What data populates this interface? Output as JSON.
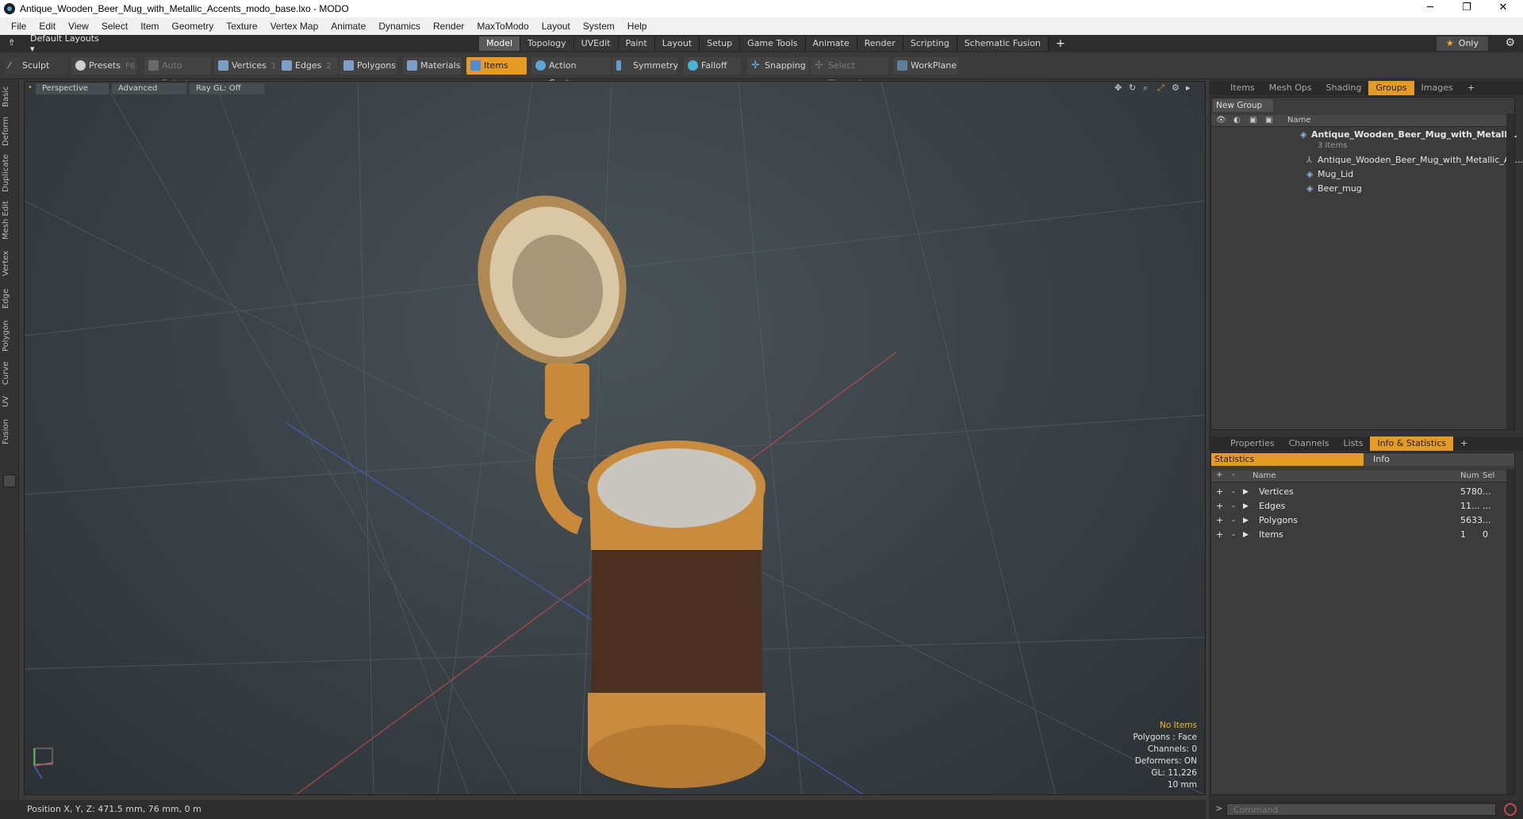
{
  "window": {
    "title": "Antique_Wooden_Beer_Mug_with_Metallic_Accents_modo_base.lxo - MODO",
    "minimize": "─",
    "maximize": "❐",
    "close": "✕"
  },
  "menu": [
    "File",
    "Edit",
    "View",
    "Select",
    "Item",
    "Geometry",
    "Texture",
    "Vertex Map",
    "Animate",
    "Dynamics",
    "Render",
    "MaxToModo",
    "Layout",
    "System",
    "Help"
  ],
  "layoutbar": {
    "layouts_label": "Default Layouts ▾",
    "tabs": [
      "Model",
      "Topology",
      "UVEdit",
      "Paint",
      "Layout",
      "Setup",
      "Game Tools",
      "Animate",
      "Render",
      "Scripting",
      "Schematic Fusion"
    ],
    "active_tab": "Model",
    "add": "+",
    "only_label": "Only"
  },
  "toolbar": {
    "sculpt": "Sculpt",
    "presets": "Presets",
    "presets_hotkey": "F6",
    "auto_select": "Auto Select",
    "vertices": "Vertices",
    "vertices_hotkey": "1",
    "edges": "Edges",
    "edges_hotkey": "2",
    "polygons": "Polygons",
    "materials": "Materials",
    "items": "Items",
    "action_center": "Action Center",
    "symmetry": "Symmetry",
    "falloff": "Falloff",
    "snapping": "Snapping",
    "select_through": "Select Through",
    "workplane": "WorkPlane"
  },
  "left_tabs": [
    "Basic",
    "Deform",
    "Duplicate",
    "Mesh Edit",
    "Vertex",
    "Edge",
    "Polygon",
    "Curve",
    "UV",
    "Fusion"
  ],
  "viewport": {
    "perspective": "Perspective",
    "advanced": "Advanced",
    "raygl": "Ray GL: Off",
    "info": {
      "no_items": "No Items",
      "polygons": "Polygons : Face",
      "channels": "Channels: 0",
      "deformers": "Deformers: ON",
      "gl": "GL: 11,226",
      "scale": "10 mm"
    }
  },
  "items_panel": {
    "tabs": [
      "Items",
      "Mesh Ops",
      "Shading",
      "Groups",
      "Images"
    ],
    "active_tab": "Groups",
    "new_group": "New Group",
    "name_header": "Name",
    "group_name": "Antique_Wooden_Beer_Mug_with_Metall...",
    "group_count": "3 Items",
    "children": [
      "Antique_Wooden_Beer_Mug_with_Metallic_Ac...",
      "Mug_Lid",
      "Beer_mug"
    ]
  },
  "stats_panel": {
    "tabs": [
      "Properties",
      "Channels",
      "Lists",
      "Info & Statistics"
    ],
    "active_tab": "Info & Statistics",
    "sub_tabs": [
      "Statistics",
      "Info"
    ],
    "headers": {
      "name": "Name",
      "num": "Num",
      "sel": "Sel"
    },
    "rows": [
      {
        "name": "Vertices",
        "num": "5780",
        "sel": "..."
      },
      {
        "name": "Edges",
        "num": "11...",
        "sel": "..."
      },
      {
        "name": "Polygons",
        "num": "5633",
        "sel": "..."
      },
      {
        "name": "Items",
        "num": "1",
        "sel": "0"
      }
    ]
  },
  "status": {
    "position": "Position X, Y, Z:   471.5 mm, 76 mm, 0 m",
    "command_placeholder": "Command",
    "prompt": ">"
  }
}
